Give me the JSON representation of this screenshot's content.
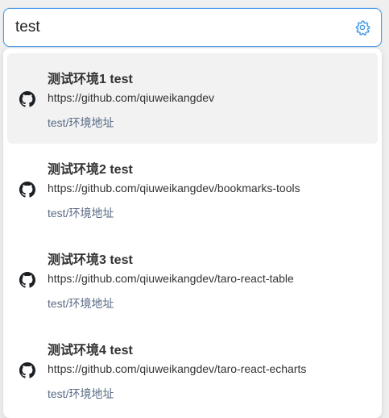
{
  "search": {
    "value": "test"
  },
  "settings": {
    "icon": "gear-icon",
    "color": "#4a9be8"
  },
  "results": [
    {
      "title": "测试环境1 test",
      "url": "https://github.com/qiuweikangdev",
      "path": "test/环境地址",
      "icon": "github-icon",
      "active": true
    },
    {
      "title": "测试环境2 test",
      "url": "https://github.com/qiuweikangdev/bookmarks-tools",
      "path": "test/环境地址",
      "icon": "github-icon",
      "active": false
    },
    {
      "title": "测试环境3 test",
      "url": "https://github.com/qiuweikangdev/taro-react-table",
      "path": "test/环境地址",
      "icon": "github-icon",
      "active": false
    },
    {
      "title": "测试环境4 test",
      "url": "https://github.com/qiuweikangdev/taro-react-echarts",
      "path": "test/环境地址",
      "icon": "github-icon",
      "active": false
    }
  ]
}
